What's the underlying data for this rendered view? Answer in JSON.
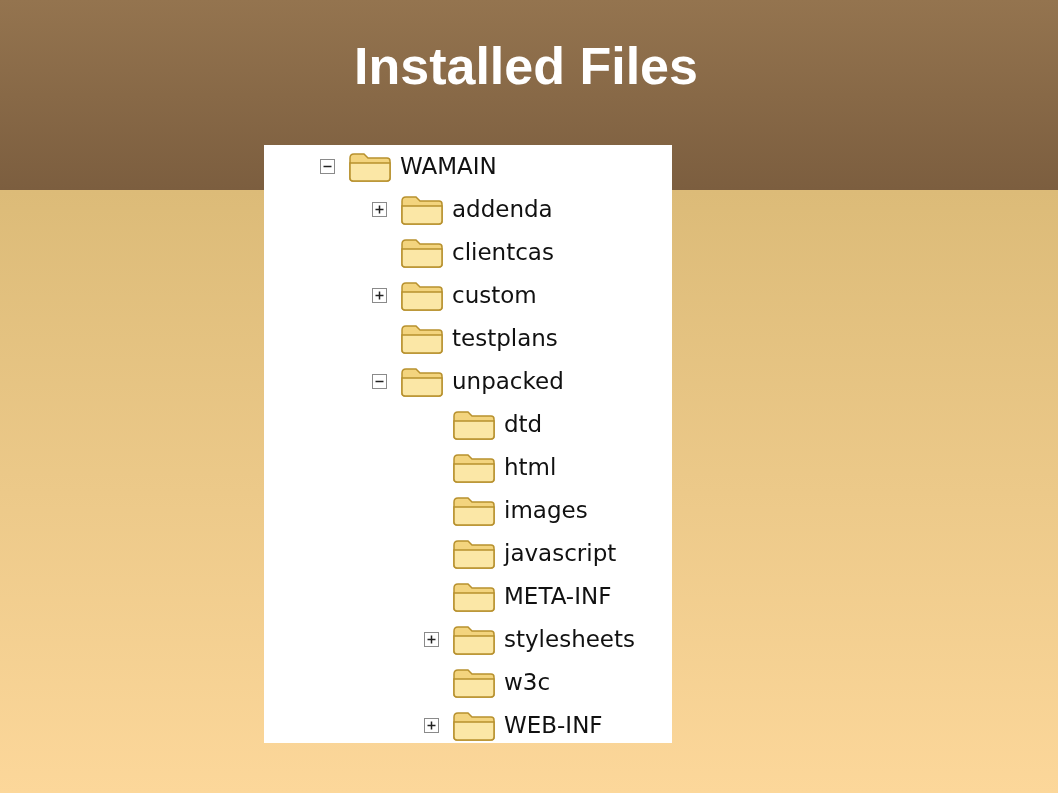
{
  "title": "Installed Files",
  "tree": {
    "label": "WAMAIN",
    "kind": "node",
    "expanded": true,
    "children": [
      {
        "label": "addenda",
        "kind": "node",
        "expanded": false
      },
      {
        "label": "clientcas",
        "kind": "leaf"
      },
      {
        "label": "custom",
        "kind": "node",
        "expanded": false
      },
      {
        "label": "testplans",
        "kind": "leaf"
      },
      {
        "label": "unpacked",
        "kind": "node",
        "expanded": true,
        "children": [
          {
            "label": "dtd",
            "kind": "leaf"
          },
          {
            "label": "html",
            "kind": "leaf"
          },
          {
            "label": "images",
            "kind": "leaf"
          },
          {
            "label": "javascript",
            "kind": "leaf"
          },
          {
            "label": "META-INF",
            "kind": "leaf"
          },
          {
            "label": "stylesheets",
            "kind": "node",
            "expanded": false
          },
          {
            "label": "w3c",
            "kind": "leaf"
          },
          {
            "label": "WEB-INF",
            "kind": "node",
            "expanded": false
          }
        ]
      }
    ]
  }
}
